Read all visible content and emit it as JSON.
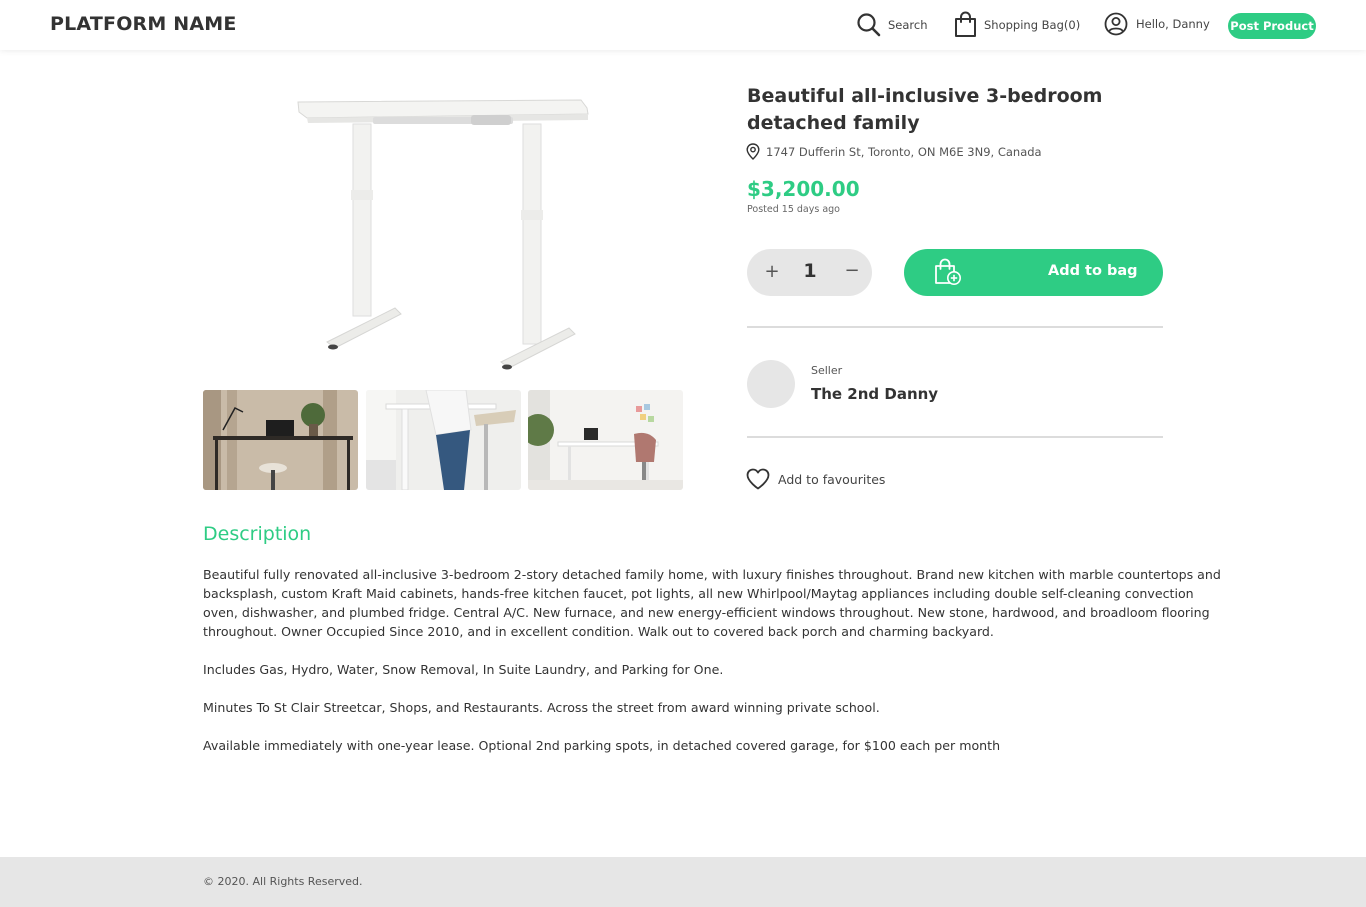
{
  "header": {
    "brand": "PLATFORM NAME",
    "search_label": "Search",
    "bag_label": "Shopping Bag(0)",
    "user_label": "Hello, Danny",
    "post_button": "Post Product"
  },
  "product": {
    "title": "Beautiful all-inclusive 3-bedroom detached family",
    "address": "1747 Dufferin St, Toronto, ON M6E 3N9, Canada",
    "price": "$3,200.00",
    "posted": "Posted 15 days ago",
    "quantity": "1",
    "add_to_bag": "Add to bag",
    "add_to_favourites": "Add to favourites"
  },
  "seller": {
    "label": "Seller",
    "name": "The 2nd Danny"
  },
  "description": {
    "heading": "Description",
    "paragraphs": [
      "Beautiful fully renovated all-inclusive 3-bedroom 2-story detached family home, with luxury finishes throughout. Brand new kitchen with marble countertops and backsplash, custom Kraft Maid cabinets, hands-free kitchen faucet, pot lights, all new Whirlpool/Maytag appliances including double self-cleaning convection oven, dishwasher, and plumbed fridge. Central A/C. New furnace, and new energy-efficient windows throughout. New stone, hardwood, and broadloom flooring throughout. Owner Occupied Since 2010, and in excellent condition. Walk out to covered back porch and charming backyard.",
      "Includes Gas, Hydro, Water, Snow Removal, In Suite Laundry, and Parking for One.",
      "Minutes To St Clair Streetcar, Shops, and Restaurants. Across the street from award winning private school.",
      "Available immediately with one-year lease. Optional 2nd parking spots, in detached covered garage, for $100 each per month"
    ]
  },
  "footer": {
    "copyright": "© 2020. All Rights Reserved."
  },
  "colors": {
    "accent": "#2ecc84",
    "control_bg": "#e6e6e6",
    "footer_bg": "#e6e6e6"
  },
  "icons": {
    "search": "search-icon",
    "bag": "shopping-bag-icon",
    "user": "user-circle-icon",
    "location": "map-pin-icon",
    "add_bag": "bag-plus-icon",
    "favourite": "heart-icon"
  }
}
